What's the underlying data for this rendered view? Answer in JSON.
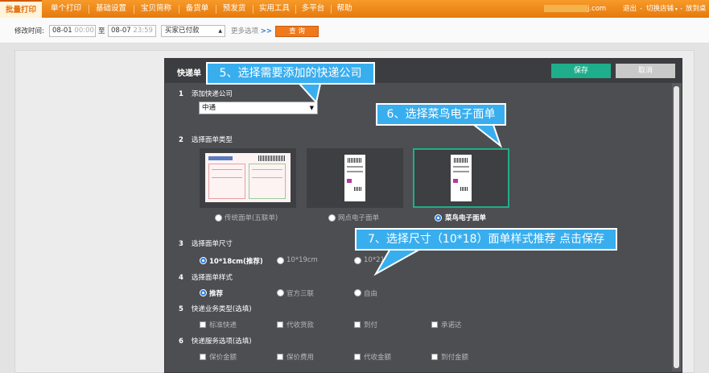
{
  "topnav": {
    "items": [
      "批量打印",
      "单个打印",
      "基础设置",
      "宝贝简称",
      "备货单",
      "预发货",
      "实用工具",
      "多平台",
      "帮助"
    ],
    "account_suffix": "j.com",
    "right_links": [
      "退出",
      "切换店铺",
      "放到桌"
    ]
  },
  "filterbar": {
    "label": "修改时间:",
    "start_date": "08-01",
    "start_time": "00:00",
    "to": "至",
    "end_date": "08-07",
    "end_time": "23:59",
    "status_select": "买家已付款",
    "more_options": "更多选项",
    "more_chev": ">>",
    "query_button": "查  询"
  },
  "dialog": {
    "title": "快递单",
    "save_button": "保存",
    "cancel_button": "取消",
    "sections": [
      {
        "num": "1",
        "label": "添加快递公司"
      },
      {
        "num": "2",
        "label": "选择面单类型"
      },
      {
        "num": "3",
        "label": "选择面单尺寸"
      },
      {
        "num": "4",
        "label": "选择面单样式"
      },
      {
        "num": "5",
        "label": "快递业务类型(选填)"
      },
      {
        "num": "6",
        "label": "快递服务选项(选填)"
      }
    ],
    "company_select": "中通",
    "template_types": [
      {
        "label": "传统面单(五联单)",
        "selected": false
      },
      {
        "label": "网点电子面单",
        "selected": false
      },
      {
        "label": "菜鸟电子面单",
        "selected": true
      }
    ],
    "sizes": [
      {
        "label": "10*18cm(推荐)",
        "selected": true
      },
      {
        "label": "10*19cm",
        "selected": false
      },
      {
        "label": "10*21cm",
        "selected": false
      }
    ],
    "styles": [
      {
        "label": "推荐",
        "selected": true
      },
      {
        "label": "官方三联",
        "selected": false
      },
      {
        "label": "自由",
        "selected": false
      }
    ],
    "business_types": [
      "标准快递",
      "代收货款",
      "到付",
      "承诺达"
    ],
    "service_options": [
      "保价金额",
      "保价费用",
      "代收金额",
      "到付金额"
    ]
  },
  "callouts": {
    "step5": "5、选择需要添加的快递公司",
    "step6": "6、选择菜鸟电子面单",
    "step7": "7、选择尺寸（10*18）面单样式推荐 点击保存"
  },
  "colors": {
    "nav_orange": "#f08a1c",
    "accent_green": "#1fae8b",
    "callout_blue": "#39aeef",
    "radio_blue": "#2a7de1"
  }
}
